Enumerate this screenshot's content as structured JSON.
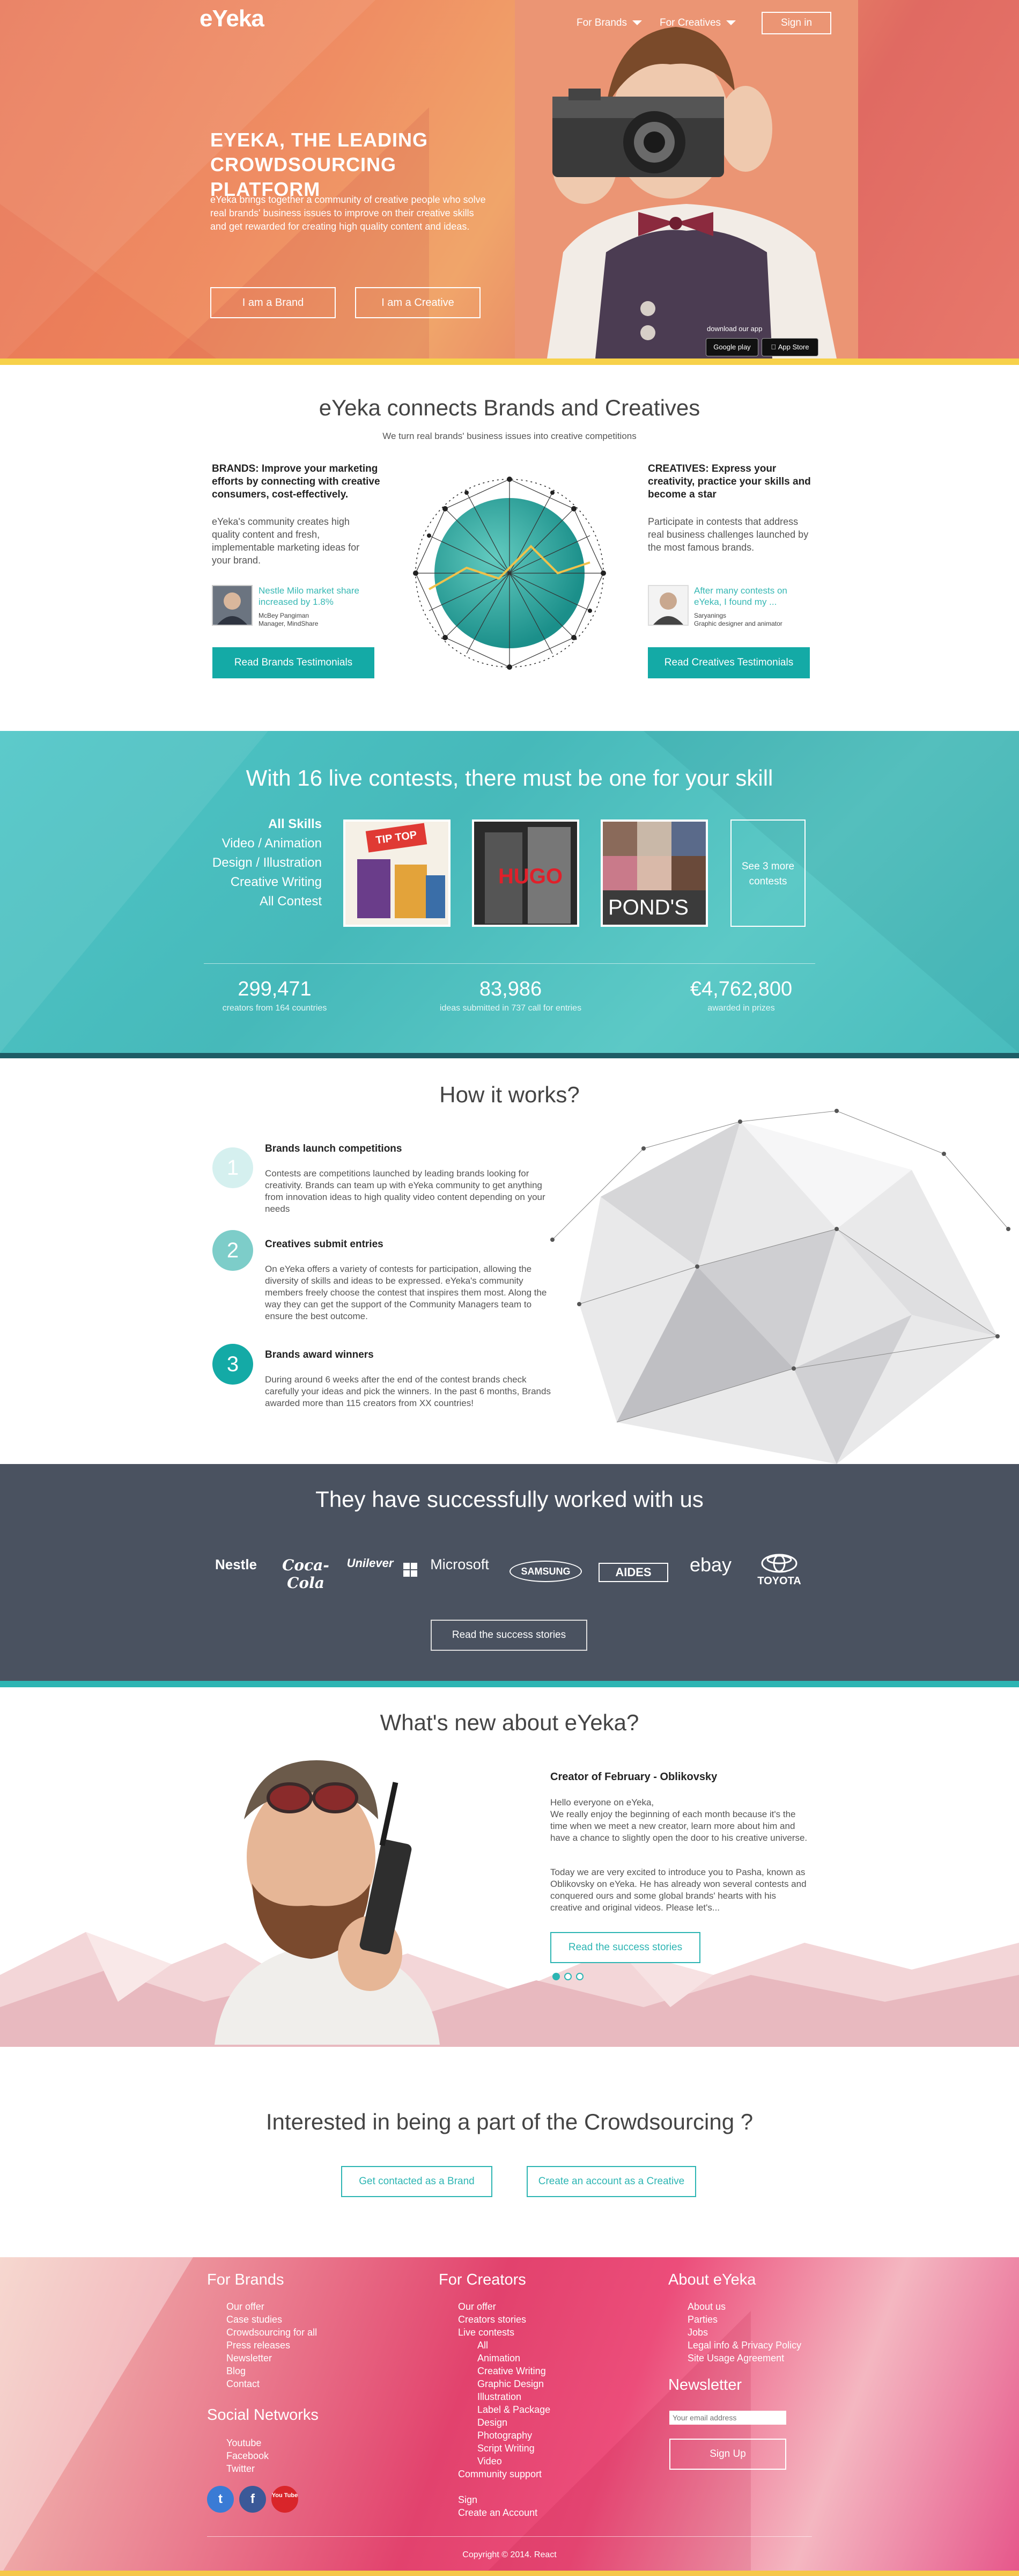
{
  "header": {
    "logo": "eYeka",
    "nav": [
      {
        "label": "For Brands"
      },
      {
        "label": "For Creatives"
      }
    ],
    "signin": "Sign in"
  },
  "hero": {
    "title": "EYEKA, THE LEADING CROWDSOURCING PLATFORM",
    "description": "eYeka brings together a community of creative people who solve real brands' business issues to improve on their creative skills and get rewarded for creating high quality content and ideas.",
    "brand_button": "I am a Brand",
    "creative_button": "I am a Creative",
    "app_label": "download our app",
    "google_play": "Google play",
    "app_store": "App Store"
  },
  "connect": {
    "title": "eYeka connects Brands and Creatives",
    "subtitle": "We turn real brands' business issues into creative competitions",
    "brands": {
      "heading": "BRANDS: Improve your marketing efforts by connecting with creative consumers, cost-effectively.",
      "text": "eYeka's community creates high quality content and fresh, implementable marketing ideas for your brand.",
      "quote": "Nestle Milo market share increased by 1.8%",
      "person_name": "McBey Pangiman",
      "person_role": "Manager, MindShare",
      "button": "Read Brands Testimonials"
    },
    "creatives": {
      "heading": "CREATIVES: Express your creativity, practice your skills and become a star",
      "text": "Participate in contests that address real business challenges launched by the most famous brands.",
      "quote": "After many contests on eYeka, I found my ...",
      "person_name": "Saryanings",
      "person_role": "Graphic designer and animator",
      "button": "Read Creatives Testimonials"
    }
  },
  "contests": {
    "title": "With 16 live contests, there must be one for your skill",
    "skills": [
      "All Skills",
      "Video / Animation",
      "Design / Illustration",
      "Creative Writing",
      "All Contest"
    ],
    "thumbs": [
      {
        "label": "TIP TOP"
      },
      {
        "label": "HUGO"
      },
      {
        "label": "POND'S"
      }
    ],
    "more": "See 3 more contests",
    "stats": [
      {
        "value": "299,471",
        "label": "creators from 164 countries"
      },
      {
        "value": "83,986",
        "label": "ideas submitted in 737 call for entries"
      },
      {
        "value": "€4,762,800",
        "label": "awarded in prizes"
      }
    ]
  },
  "how": {
    "title": "How it works?",
    "steps": [
      {
        "num": "1",
        "heading": "Brands launch competitions",
        "text": "Contests are competitions launched by leading brands looking for creativity. Brands can team up with eYeka community to get anything from innovation ideas to high quality video content depending on your needs"
      },
      {
        "num": "2",
        "heading": "Creatives submit entries",
        "text": "On eYeka offers a variety of contests for participation, allowing the diversity of skills and ideas to be expressed. eYeka's community members freely choose the contest that inspires them most. Along the way they can get the support of the Community Managers team to ensure the best outcome."
      },
      {
        "num": "3",
        "heading": "Brands award winners",
        "text": "During around 6 weeks after the end of the contest brands check carefully your ideas and pick the winners. In the past 6 months, Brands awarded more than 115 creators from XX countries!"
      }
    ]
  },
  "brands": {
    "title": "They have successfully worked with us",
    "logos": [
      "Nestle",
      "Coca-Cola",
      "Unilever",
      "Microsoft",
      "SAMSUNG",
      "AIDES",
      "ebay",
      "TOYOTA"
    ],
    "button": "Read the success stories"
  },
  "news": {
    "title": "What's new about eYeka?",
    "heading": "Creator of February - Oblikovsky",
    "paragraph1": "Hello everyone on eYeka,\nWe really enjoy the beginning of each month because it's the time when we meet a new creator, learn more about him and have a chance to slightly open the door to his creative universe.",
    "paragraph2": "Today we are very excited to introduce you to Pasha, known as Oblikovsky on eYeka. He has already won several contests and conquered ours and some global brands' hearts with his creative and original videos. Please let's...",
    "button": "Read the success stories"
  },
  "interest": {
    "title": "Interested in being a part of the Crowdsourcing ?",
    "brand_button": "Get contacted as a Brand",
    "creative_button": "Create an account as a Creative"
  },
  "footer": {
    "for_brands": {
      "title": "For Brands",
      "links": [
        "Our offer",
        "Case studies",
        "Crowdsourcing for all",
        "Press releases",
        "Newsletter",
        "Blog",
        "Contact"
      ]
    },
    "social": {
      "title": "Social Networks",
      "links": [
        "Youtube",
        "Facebook",
        "Twitter"
      ],
      "icons": [
        {
          "name": "twitter-icon",
          "glyph": "t",
          "color": "#3a7bd5"
        },
        {
          "name": "facebook-icon",
          "glyph": "f",
          "color": "#3b5998"
        },
        {
          "name": "youtube-icon",
          "glyph": "You Tube",
          "color": "#d9252a"
        }
      ]
    },
    "for_creators": {
      "title": "For Creators",
      "links": [
        "Our offer",
        "Creators stories",
        "Live contests"
      ],
      "sub_links": [
        "All",
        "Animation",
        "Creative Writing",
        "Graphic Design",
        "Illustration",
        "Label & Package",
        "Design",
        "Photography",
        "Script Writing",
        "Video"
      ],
      "links2": [
        "Community support"
      ],
      "links3": [
        "Sign",
        "Create an Account"
      ]
    },
    "about": {
      "title": "About eYeka",
      "links": [
        "About us",
        "Parties",
        "Jobs",
        "Legal info & Privacy Policy",
        "Site Usage Agreement"
      ]
    },
    "newsletter": {
      "title": "Newsletter",
      "placeholder": "Your email address",
      "button": "Sign Up"
    },
    "copyright": "Copyright © 2014. React"
  }
}
